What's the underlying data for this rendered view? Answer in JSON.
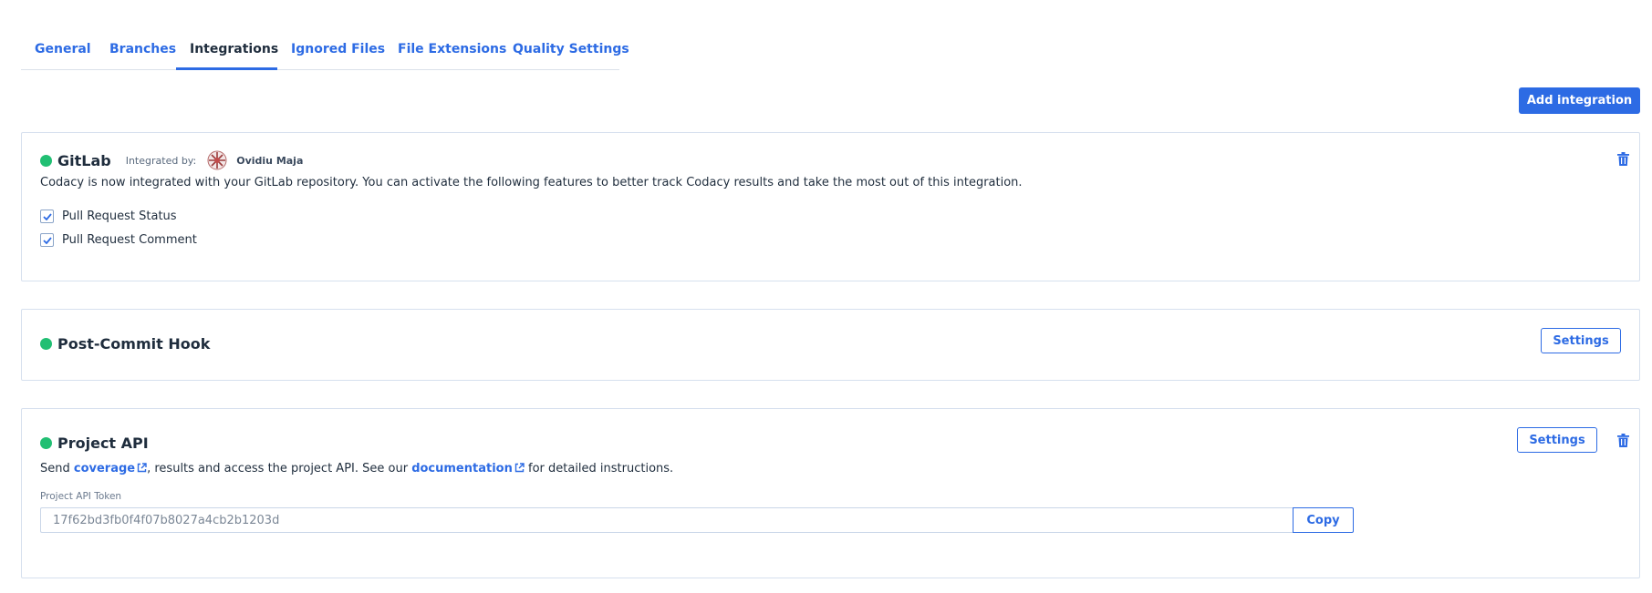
{
  "tabs": [
    {
      "label": "General",
      "active": false
    },
    {
      "label": "Branches",
      "active": false
    },
    {
      "label": "Integrations",
      "active": true
    },
    {
      "label": "Ignored Files",
      "active": false
    },
    {
      "label": "File Extensions",
      "active": false
    },
    {
      "label": "Quality Settings",
      "active": false
    }
  ],
  "toolbar": {
    "add_integration_label": "Add integration"
  },
  "colors": {
    "accent": "#2d6be4",
    "status_active": "#21bf73",
    "text": "#1f2d3d",
    "card_border": "#d6e0ee"
  },
  "gitlab": {
    "title": "GitLab",
    "integrated_by_label": "Integrated by:",
    "user_name": "Ovidiu Maja",
    "avatar_icon": "avatar-image",
    "description": "Codacy is now integrated with your GitLab repository. You can activate the following features to better track Codacy results and take the most out of this integration.",
    "options": [
      {
        "label": "Pull Request Status",
        "checked": true
      },
      {
        "label": "Pull Request Comment",
        "checked": true
      }
    ],
    "delete_icon": "trash-icon"
  },
  "post_commit_hook": {
    "title": "Post-Commit Hook",
    "settings_label": "Settings"
  },
  "project_api": {
    "title": "Project API",
    "settings_label": "Settings",
    "delete_icon": "trash-icon",
    "desc_prefix": "Send ",
    "coverage_link": "coverage",
    "desc_middle": ", results and access the project API. See our ",
    "documentation_link": "documentation",
    "desc_suffix": " for detailed instructions.",
    "token_label": "Project API Token",
    "token_value": "17f62bd3fb0f4f07b8027a4cb2b1203d",
    "copy_label": "Copy"
  }
}
